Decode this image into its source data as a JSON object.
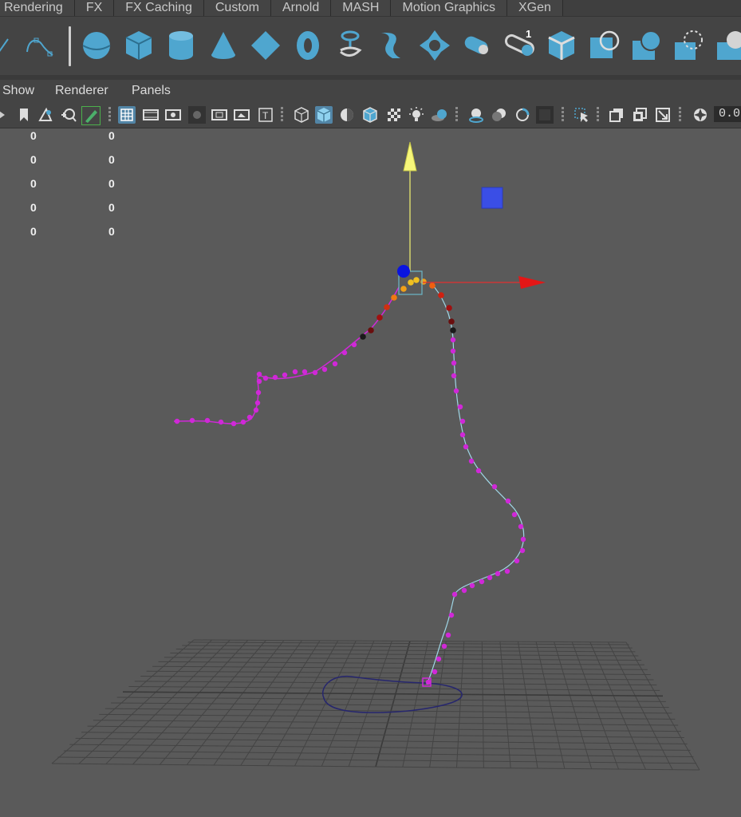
{
  "shelf_tabs": [
    "Rendering",
    "FX",
    "FX Caching",
    "Custom",
    "Arnold",
    "MASH",
    "Motion Graphics",
    "XGen"
  ],
  "shelf_icons": [
    "sphere-icon",
    "cube-icon",
    "cylinder-icon",
    "cone-icon",
    "plane-icon",
    "torus-icon",
    "mash-network-icon",
    "curve-warp-icon",
    "sweep-icon",
    "pipe-icon",
    "instancer-icon",
    "poly-cube-icon",
    "sweep-mesh-icon",
    "soft-select-icon",
    "extrude-icon",
    "lasso-icon",
    "misc-icon"
  ],
  "shelf_badge": "1",
  "panel_menu": {
    "show": "Show",
    "renderer": "Renderer",
    "panels": "Panels"
  },
  "panel_toolbar": {
    "time_value": "0.0",
    "icons": [
      "camera-icon",
      "bookmark-icon",
      "camera-attr-icon",
      "snap-icon",
      "grease-pencil-icon",
      "grid-icon",
      "film-gate-icon",
      "resolution-gate-icon",
      "gate-mask-icon",
      "field-chart-icon",
      "safe-title-icon",
      "wireframe-icon",
      "smooth-shade-icon",
      "default-material-icon",
      "wireframe-on-shaded-icon",
      "xray-icon",
      "use-lights-icon",
      "shadows-icon",
      "screen-space-ao-icon",
      "motion-blur-icon",
      "aa-icon",
      "depth-of-field-icon",
      "isolate-select-icon",
      "xray-joints-icon",
      "xray-active-icon",
      "backface-icon",
      "exposure-icon"
    ]
  },
  "hud": {
    "col1": [
      "0",
      "0",
      "0",
      "0",
      "0"
    ],
    "col2": [
      "0",
      "0",
      "0",
      "0",
      "0"
    ]
  },
  "colors": {
    "curve": "#a6d8e8",
    "cv_points": "#d028d8",
    "path_loop": "#2a2a7a",
    "manip_y": "#f3f370",
    "manip_x": "#e41616",
    "grid": "#454545"
  }
}
